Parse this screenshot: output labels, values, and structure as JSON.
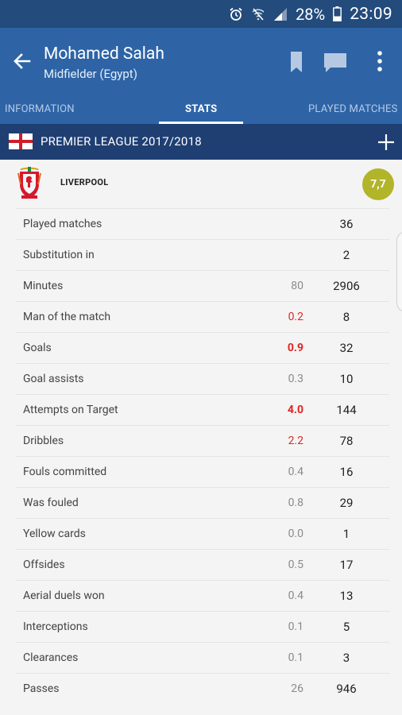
{
  "status_bar": {
    "battery_percent": "28%",
    "time": "23:09",
    "icons": [
      "alarm-icon",
      "wifi-off-icon",
      "signal-icon",
      "battery-icon"
    ]
  },
  "header": {
    "player_name": "Mohamed Salah",
    "subtitle": "Midfielder (Egypt)",
    "icons": [
      "back-arrow-icon",
      "bookmark-icon",
      "chat-icon",
      "more-vert-icon"
    ]
  },
  "tabs": [
    {
      "label": "INFORMATION",
      "active": false
    },
    {
      "label": "STATS",
      "active": true
    },
    {
      "label": "PLAYED MATCHES",
      "active": false
    }
  ],
  "league": {
    "flag": "england-flag-icon",
    "name": "PREMIER LEAGUE 2017/2018",
    "action_icon": "plus-icon"
  },
  "team": {
    "name": "LIVERPOOL",
    "crest_icon": "liverpool-crest-icon",
    "rating": "7,7",
    "rating_color": "#b2b42a"
  },
  "colors": {
    "status_bar": "#234b7c",
    "app_bar": "#2e64a6",
    "league_bar": "#1f3f73",
    "highlight": "#e02424"
  },
  "stats": [
    {
      "label": "Played matches",
      "avg": "",
      "avg_style": "",
      "total": "36"
    },
    {
      "label": "Substitution in",
      "avg": "",
      "avg_style": "",
      "total": "2"
    },
    {
      "label": "Minutes",
      "avg": "80",
      "avg_style": "",
      "total": "2906"
    },
    {
      "label": "Man of the match",
      "avg": "0.2",
      "avg_style": "hl",
      "total": "8"
    },
    {
      "label": "Goals",
      "avg": "0.9",
      "avg_style": "hl-bold",
      "total": "32"
    },
    {
      "label": "Goal assists",
      "avg": "0.3",
      "avg_style": "",
      "total": "10"
    },
    {
      "label": "Attempts on Target",
      "avg": "4.0",
      "avg_style": "hl-bold",
      "total": "144"
    },
    {
      "label": "Dribbles",
      "avg": "2.2",
      "avg_style": "hl",
      "total": "78"
    },
    {
      "label": "Fouls committed",
      "avg": "0.4",
      "avg_style": "",
      "total": "16"
    },
    {
      "label": "Was fouled",
      "avg": "0.8",
      "avg_style": "",
      "total": "29"
    },
    {
      "label": "Yellow cards",
      "avg": "0.0",
      "avg_style": "",
      "total": "1"
    },
    {
      "label": "Offsides",
      "avg": "0.5",
      "avg_style": "",
      "total": "17"
    },
    {
      "label": "Aerial duels won",
      "avg": "0.4",
      "avg_style": "",
      "total": "13"
    },
    {
      "label": "Interceptions",
      "avg": "0.1",
      "avg_style": "",
      "total": "5"
    },
    {
      "label": "Clearances",
      "avg": "0.1",
      "avg_style": "",
      "total": "3"
    },
    {
      "label": "Passes",
      "avg": "26",
      "avg_style": "",
      "total": "946"
    }
  ]
}
